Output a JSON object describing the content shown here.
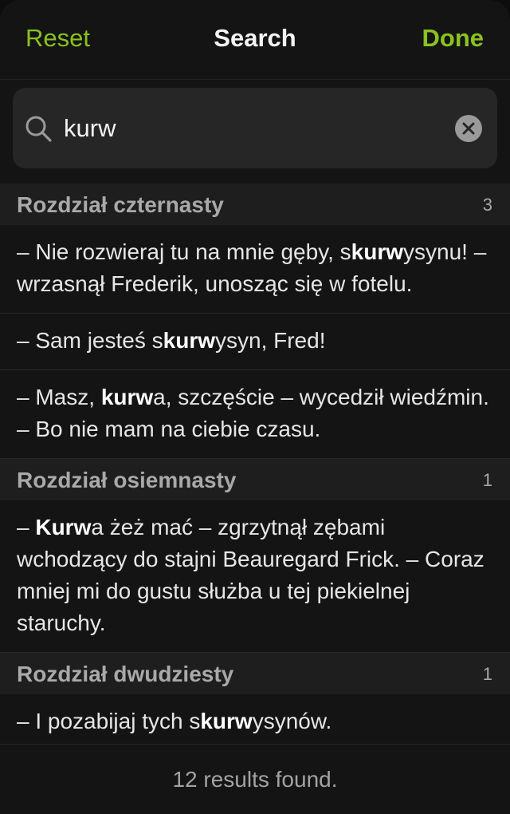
{
  "header": {
    "reset_label": "Reset",
    "title": "Search",
    "done_label": "Done"
  },
  "search": {
    "value": "kurw",
    "clear_icon": "clear-circle-icon",
    "search_icon": "magnifier-icon"
  },
  "colors": {
    "accent": "#8ac21f",
    "background": "#141414",
    "section_header_bg": "#1e1e1e"
  },
  "sections": [
    {
      "title": "Rozdział czternasty",
      "count": "3",
      "results": [
        {
          "pre": "– Nie rozwieraj tu na mnie gęby, s",
          "match": "kurw",
          "post": "ysynu! – wrzasnął Frederik, unosząc się w fotelu."
        },
        {
          "pre": "– Sam jesteś s",
          "match": "kurw",
          "post": "ysyn, Fred!"
        },
        {
          "pre": "– Masz, ",
          "match": "kurw",
          "post": "a, szczęście – wycedził wiedźmin. – Bo nie mam na ciebie czasu."
        }
      ]
    },
    {
      "title": "Rozdział osiemnasty",
      "count": "1",
      "results": [
        {
          "pre": "– ",
          "match": "Kurw",
          "post": "a żeż mać – zgrzytnął zębami wchodzący do stajni Beauregard Frick. – Coraz mniej mi do gustu służba u tej piekielnej staruchy."
        }
      ]
    },
    {
      "title": "Rozdział dwudziesty",
      "count": "1",
      "results": [
        {
          "pre": "– I pozabijaj tych s",
          "match": "kurw",
          "post": "ysynów."
        }
      ]
    }
  ],
  "footer": {
    "summary": "12 results found."
  }
}
